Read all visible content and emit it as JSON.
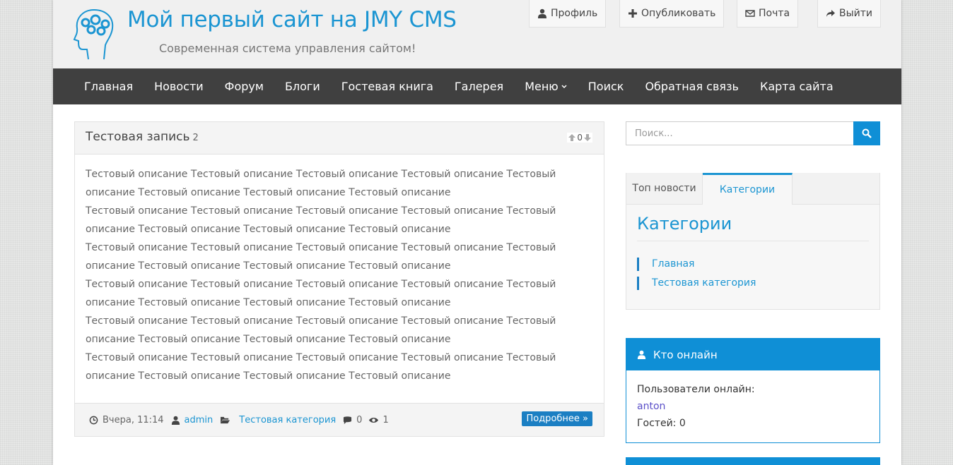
{
  "site": {
    "title": "Мой первый сайт на JMY CMS",
    "subtitle": "Современная система управления сайтом!"
  },
  "top_buttons": {
    "profile": "Профиль",
    "publish": "Опубликовать",
    "mail": "Почта",
    "logout": "Выйти"
  },
  "nav": {
    "items": [
      "Главная",
      "Новости",
      "Форум",
      "Блоги",
      "Гостевая книга",
      "Галерея",
      "Меню",
      "Поиск",
      "Обратная связь",
      "Карта сайта"
    ]
  },
  "article": {
    "title": "Тестовая запись",
    "count": "2",
    "rating": "0",
    "paragraphs": [
      "Тестовый описание Тестовый описание Тестовый описание Тестовый описание Тестовый описание Тестовый описание Тестовый описание Тестовый описание",
      "Тестовый описание Тестовый описание Тестовый описание Тестовый описание Тестовый описание Тестовый описание Тестовый описание Тестовый описание",
      "Тестовый описание Тестовый описание Тестовый описание Тестовый описание Тестовый описание Тестовый описание Тестовый описание Тестовый описание",
      "Тестовый описание Тестовый описание Тестовый описание Тестовый описание Тестовый описание Тестовый описание Тестовый описание Тестовый описание",
      "Тестовый описание Тестовый описание Тестовый описание Тестовый описание Тестовый описание Тестовый описание Тестовый описание Тестовый описание",
      "Тестовый описание Тестовый описание Тестовый описание Тестовый описание Тестовый описание Тестовый описание Тестовый описание Тестовый описание"
    ],
    "date": "Вчера, 11:14",
    "author": "admin",
    "category": "Тестовая категория",
    "comments": "0",
    "views": "1",
    "more_label": "Подробнее »"
  },
  "sidebar": {
    "search_placeholder": "Поиск...",
    "tabs": [
      "Топ новости",
      "Категории"
    ],
    "categories_heading": "Категории",
    "categories": [
      "Главная",
      "Тестовая категория"
    ],
    "online": {
      "title": "Кто онлайн",
      "users_label": "Пользователи онлайн:",
      "user": "anton",
      "guests_label": "Гостей: 0"
    }
  },
  "colors": {
    "accent": "#1b95d2",
    "nav_bg": "#404040",
    "online_bg": "#0f8fd6"
  }
}
